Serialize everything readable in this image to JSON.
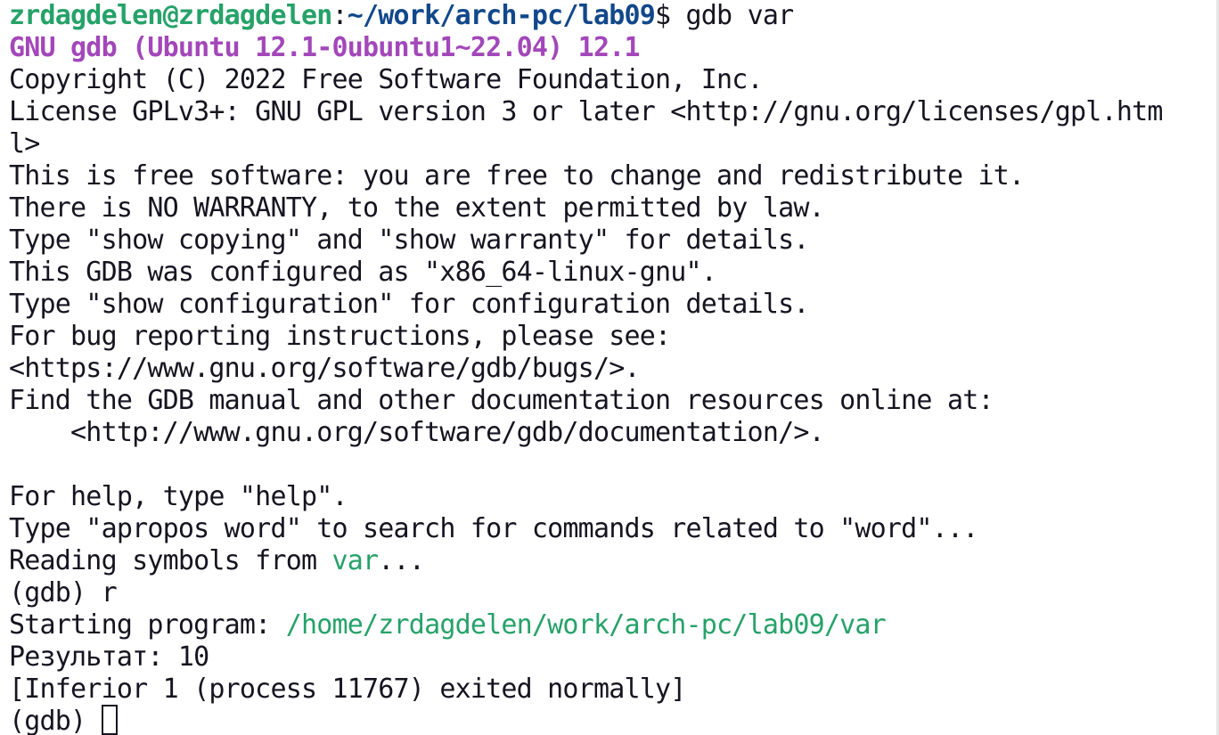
{
  "prompt": {
    "user_host": "zrdagdelen@zrdagdelen",
    "separator": ":",
    "path": "~/work/arch-pc/lab09",
    "symbol": "$ ",
    "command": "gdb var"
  },
  "banner": "GNU gdb (Ubuntu 12.1-0ubuntu1~22.04) 12.1",
  "intro_lines": [
    "Copyright (C) 2022 Free Software Foundation, Inc.",
    "License GPLv3+: GNU GPL version 3 or later <http://gnu.org/licenses/gpl.htm",
    "l>",
    "This is free software: you are free to change and redistribute it.",
    "There is NO WARRANTY, to the extent permitted by law.",
    "Type \"show copying\" and \"show warranty\" for details.",
    "This GDB was configured as \"x86_64-linux-gnu\".",
    "Type \"show configuration\" for configuration details.",
    "For bug reporting instructions, please see:",
    "<https://www.gnu.org/software/gdb/bugs/>.",
    "Find the GDB manual and other documentation resources online at:",
    "    <http://www.gnu.org/software/gdb/documentation/>.",
    "",
    "For help, type \"help\".",
    "Type \"apropos word\" to search for commands related to \"word\"..."
  ],
  "reading": {
    "prefix": "Reading symbols from ",
    "file": "var",
    "suffix": "..."
  },
  "run_command": {
    "prompt": "(gdb) ",
    "input": "r"
  },
  "starting": {
    "prefix": "Starting program: ",
    "path": "/home/zrdagdelen/work/arch-pc/lab09/var"
  },
  "result_line": "Результат: 10",
  "exit_line": "[Inferior 1 (process 11767) exited normally]",
  "final_prompt": "(gdb) ",
  "colors": {
    "background": "#ffffff",
    "foreground": "#171421",
    "user_host": "#26a269",
    "path": "#12488b",
    "banner": "#a347ba",
    "filename": "#26a269"
  }
}
